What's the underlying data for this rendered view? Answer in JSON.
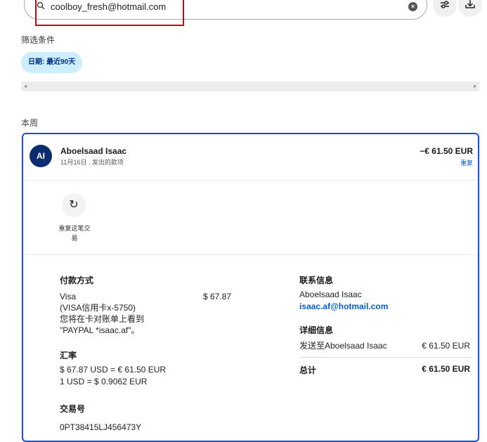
{
  "search": {
    "value": "coolboy_fresh@hotmail.com",
    "clear_icon": "×"
  },
  "filter": {
    "label": "筛选条件",
    "date_chip": "日期: 最近90天"
  },
  "scroll": {
    "left_arrow": "◂",
    "right_arrow": "▸"
  },
  "section": {
    "week_label": "本周"
  },
  "transaction": {
    "avatar_initials": "AI",
    "name": "Aboelsaad Isaac",
    "subline": "11月16日 . 发出的款项",
    "amount": "−€ 61.50 EUR",
    "repeat_link": "重复",
    "repeat_button_icon": "↻",
    "repeat_button_label": "重复这笔交易",
    "payment_method": {
      "heading": "付款方式",
      "card_name": "Visa",
      "card_detail": "(VISA信用卡x-5750)",
      "statement_note_1": "您将在卡对账单上看到",
      "statement_note_2": "\"PAYPAL *isaac.af\"。",
      "amount": "$ 67.87"
    },
    "exchange": {
      "heading": "汇率",
      "line1": "$ 67.87 USD = € 61.50 EUR",
      "line2": "1 USD = $ 0.9062 EUR"
    },
    "transaction_id": {
      "heading": "交易号",
      "value": "0PT38415LJ456473Y"
    },
    "contact": {
      "heading": "联系信息",
      "name": "Aboelsaad Isaac",
      "email": "isaac.af@hotmail.com"
    },
    "details": {
      "heading": "详细信息",
      "sent_to": "发送至Aboelsaad Isaac",
      "sent_amount": "€ 61.50 EUR",
      "total_label": "总计",
      "total_amount": "€ 61.50 EUR"
    }
  },
  "colors": {
    "accent": "#1b4fd6",
    "link": "#0a5bd6",
    "chip_bg": "#cdeefe",
    "avatar": "#0b2c6e",
    "highlight": "#d0021b"
  }
}
